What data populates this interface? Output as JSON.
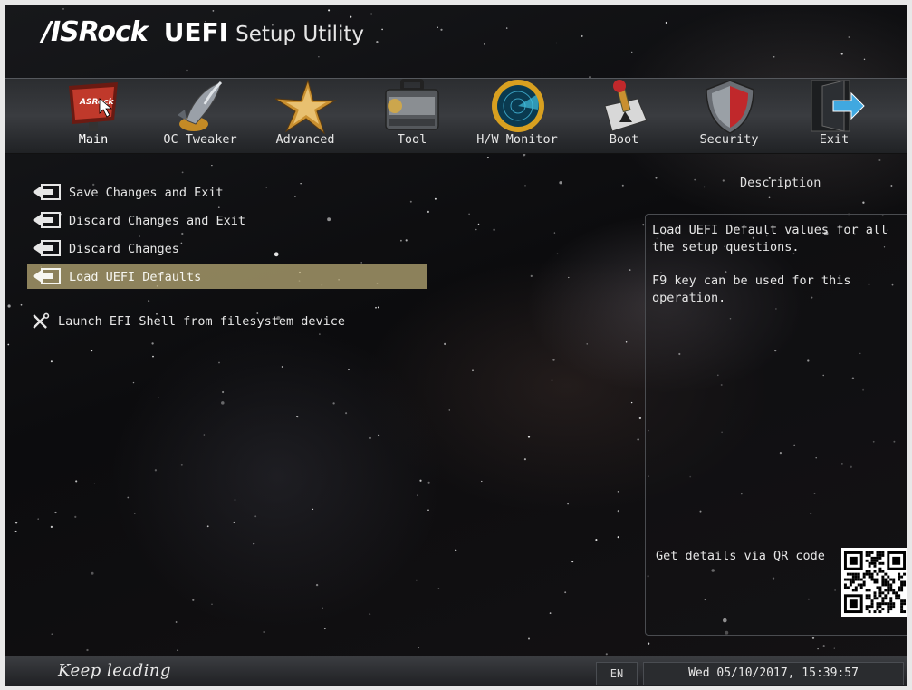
{
  "header": {
    "brand_logo": "/ISRock",
    "uefi": "UEFI",
    "setup_utility": "Setup Utility"
  },
  "nav": {
    "tabs": [
      {
        "label": "Main",
        "icon": "main-icon",
        "active": true
      },
      {
        "label": "OC Tweaker",
        "icon": "rocket-icon"
      },
      {
        "label": "Advanced",
        "icon": "star-icon"
      },
      {
        "label": "Tool",
        "icon": "toolbox-icon"
      },
      {
        "label": "H/W Monitor",
        "icon": "radar-icon"
      },
      {
        "label": "Boot",
        "icon": "boot-switch-icon"
      },
      {
        "label": "Security",
        "icon": "shield-icon"
      },
      {
        "label": "Exit",
        "icon": "exit-door-icon"
      }
    ]
  },
  "menu": {
    "items": [
      {
        "label": "Save Changes and Exit",
        "icon": "exit-arrow-icon"
      },
      {
        "label": "Discard Changes and Exit",
        "icon": "exit-arrow-icon"
      },
      {
        "label": "Discard Changes",
        "icon": "exit-arrow-icon"
      },
      {
        "label": "Load UEFI Defaults",
        "icon": "exit-arrow-icon",
        "selected": true
      },
      {
        "label": "Launch EFI Shell from filesystem device",
        "icon": "wrench-screwdriver-icon"
      }
    ]
  },
  "description": {
    "title": "Description",
    "line1": "Load UEFI Default values for all\nthe setup questions.",
    "line2": "F9 key can be used for this\noperation.",
    "qr_label": "Get details via QR code"
  },
  "footer": {
    "slogan": "Keep leading",
    "language": "EN",
    "datetime": "Wed 05/10/2017, 15:39:57"
  },
  "colors": {
    "selected_bg": "#bfae78",
    "text": "#e6e6e6"
  }
}
